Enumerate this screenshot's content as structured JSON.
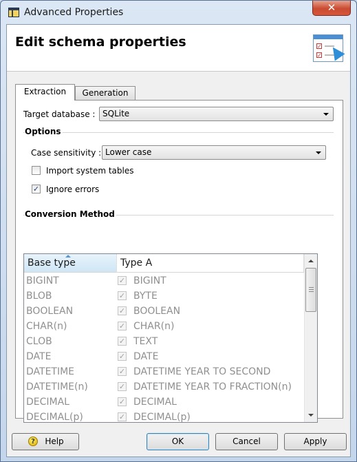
{
  "window": {
    "title": "Advanced Properties",
    "close_glyph": "✕"
  },
  "header": {
    "title": "Edit schema properties",
    "icon": "schema-properties-icon"
  },
  "tabs": [
    {
      "label": "Extraction",
      "selected": true
    },
    {
      "label": "Generation",
      "selected": false
    }
  ],
  "extraction": {
    "target_label": "Target database :",
    "target_value": "SQLite",
    "options_title": "Options",
    "case_label": "Case sensitivity :",
    "case_value": "Lower case",
    "import_system_label": "Import system tables",
    "import_system_checked": false,
    "ignore_errors_label": "Ignore errors",
    "ignore_errors_checked": true,
    "conversion_title": "Conversion Method"
  },
  "table": {
    "columns": [
      "Base type",
      "Type A"
    ],
    "rows": [
      {
        "base": "BIGINT",
        "type": "BIGINT",
        "checked": true
      },
      {
        "base": "BLOB",
        "type": "BYTE",
        "checked": true
      },
      {
        "base": "BOOLEAN",
        "type": "BOOLEAN",
        "checked": true
      },
      {
        "base": "CHAR(n)",
        "type": "CHAR(n)",
        "checked": true
      },
      {
        "base": "CLOB",
        "type": "TEXT",
        "checked": true
      },
      {
        "base": "DATE",
        "type": "DATE",
        "checked": true
      },
      {
        "base": "DATETIME",
        "type": "DATETIME YEAR TO SECOND",
        "checked": true
      },
      {
        "base": "DATETIME(n)",
        "type": "DATETIME YEAR TO FRACTION(n)",
        "checked": true
      },
      {
        "base": "DECIMAL",
        "type": "DECIMAL",
        "checked": true
      },
      {
        "base": "DECIMAL(p)",
        "type": "DECIMAL(p)",
        "checked": true
      }
    ]
  },
  "buttons": {
    "help": "Help",
    "ok": "OK",
    "cancel": "Cancel",
    "apply": "Apply"
  },
  "check_glyph": "✓"
}
